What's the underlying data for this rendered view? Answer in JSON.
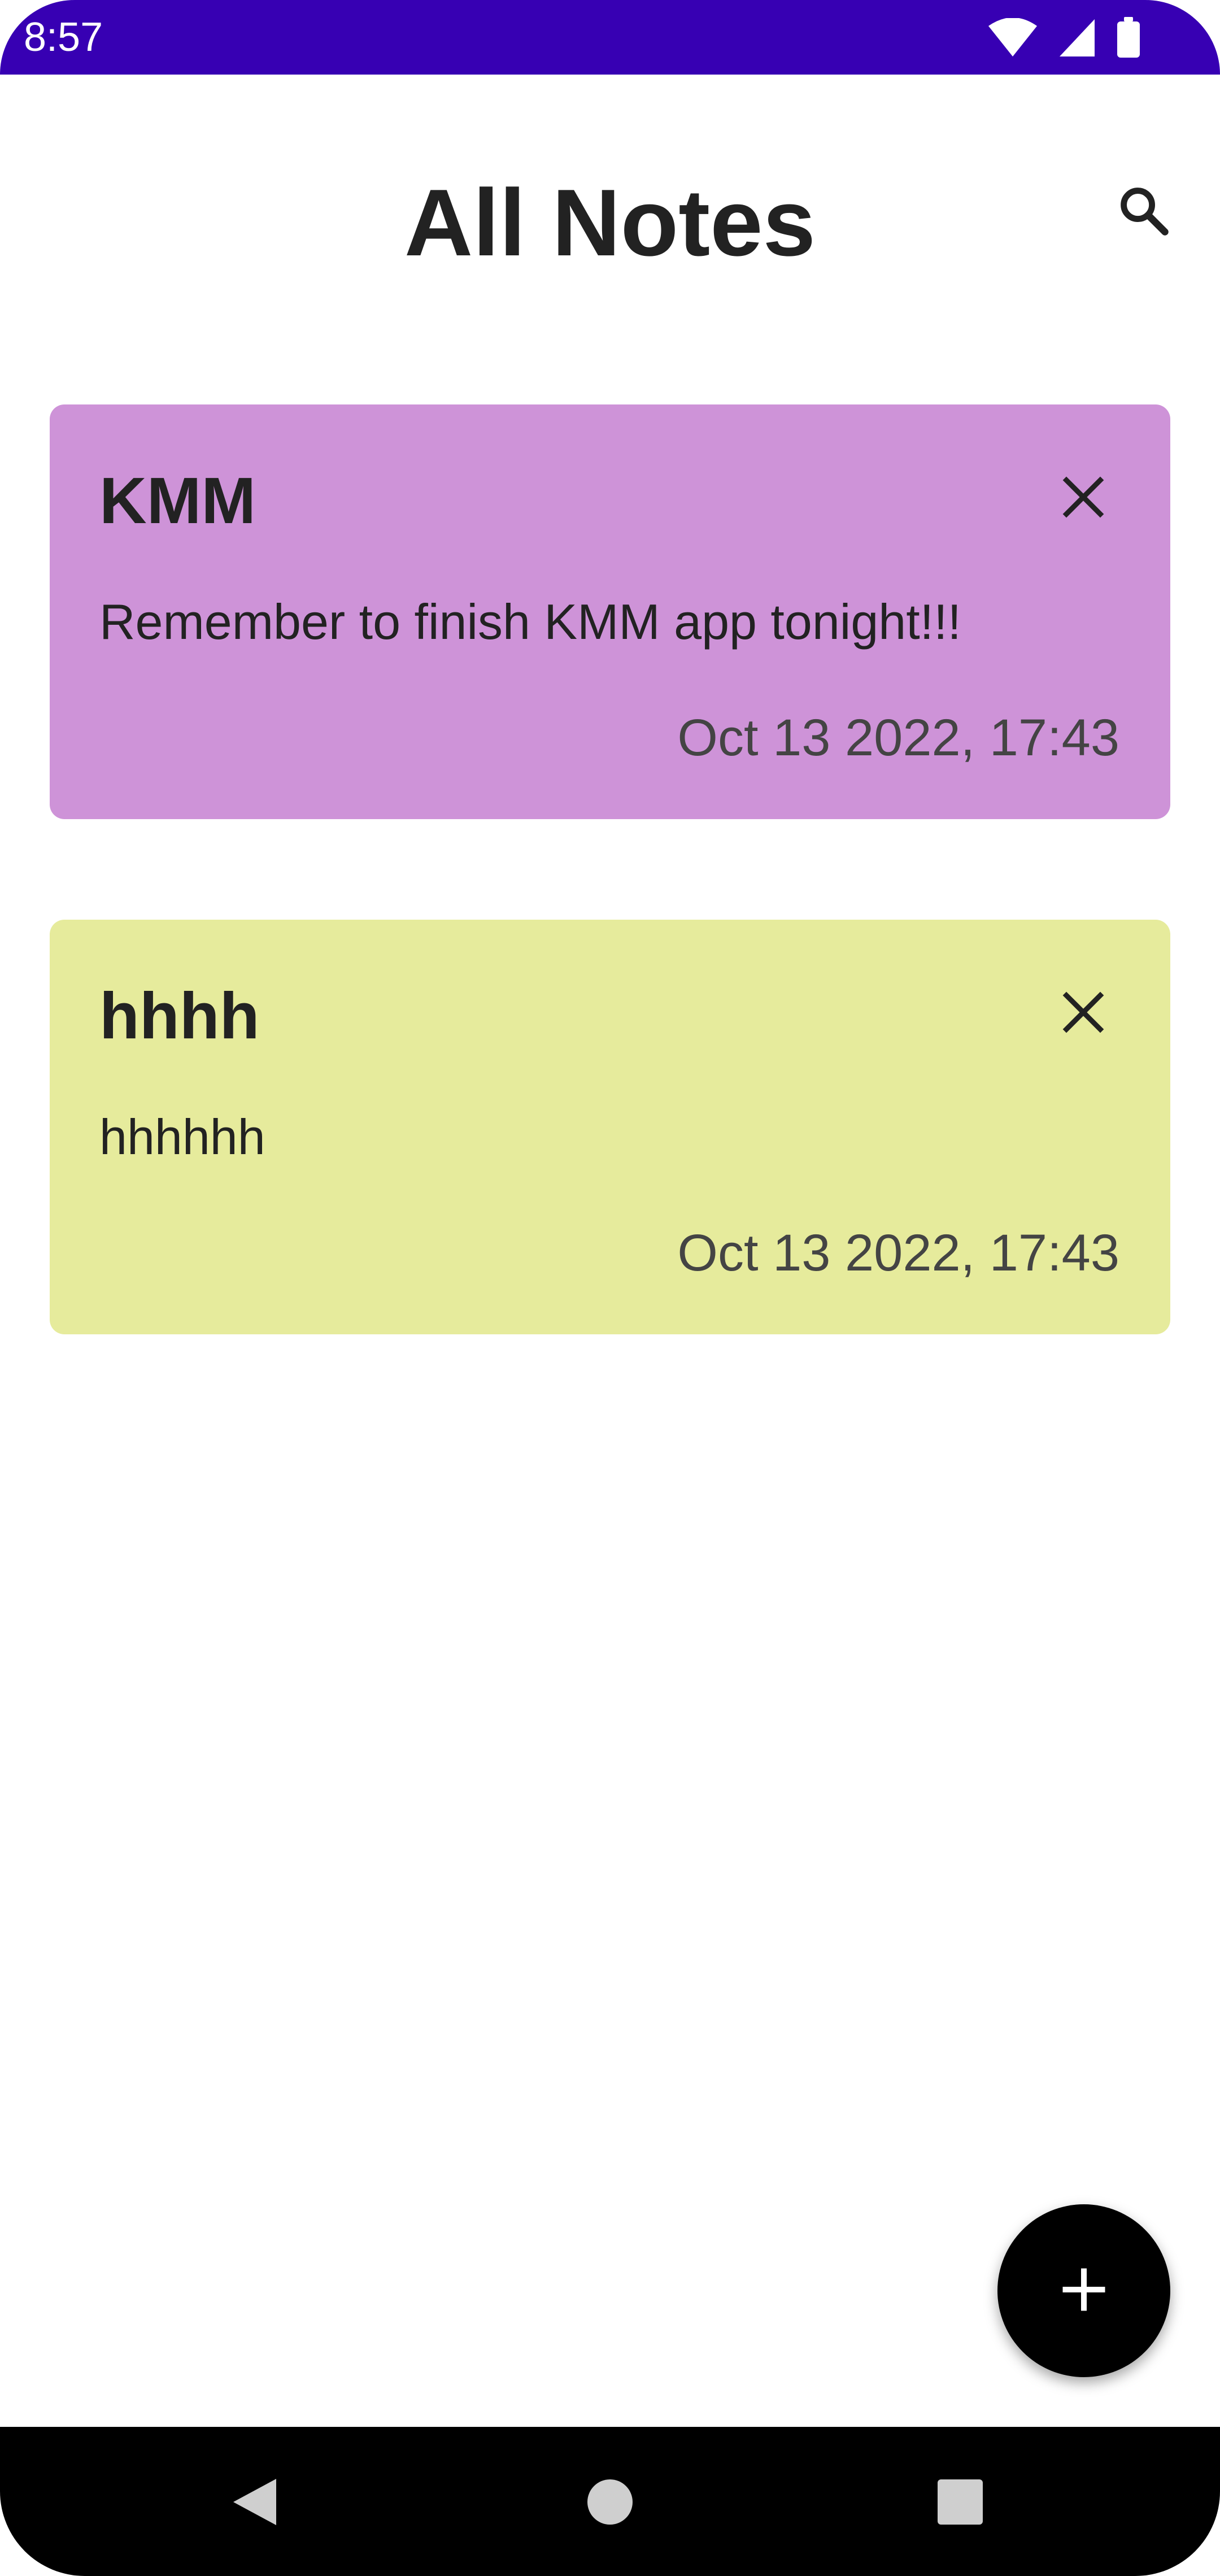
{
  "status_bar": {
    "time": "8:57",
    "background": "#3700B3",
    "icons": [
      "wifi-icon",
      "signal-icon",
      "battery-icon"
    ]
  },
  "header": {
    "title": "All Notes",
    "search_icon": "search-icon"
  },
  "notes": [
    {
      "title": "KMM",
      "body": "Remember to finish KMM app tonight!!!",
      "date": "Oct 13 2022, 17:43",
      "color": "#CE93D8",
      "delete_icon": "close-icon"
    },
    {
      "title": "hhhh",
      "body": "hhhhhh",
      "date": "Oct 13 2022, 17:43",
      "color": "#E6EB9C",
      "delete_icon": "close-icon"
    }
  ],
  "fab": {
    "icon": "add-icon",
    "color": "#000000"
  },
  "navigation_bar": {
    "buttons": [
      "back-icon",
      "home-icon",
      "recents-icon"
    ]
  }
}
